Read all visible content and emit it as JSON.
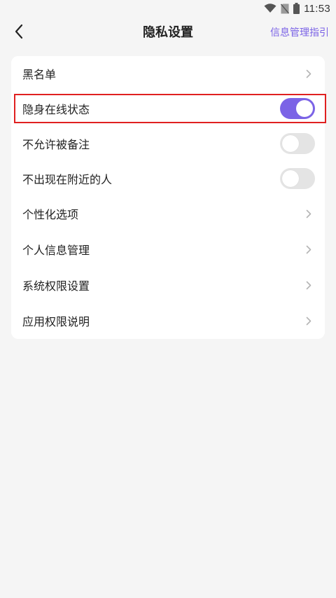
{
  "status_bar": {
    "time": "11:53",
    "icons": [
      "wifi-icon",
      "no-sim-icon",
      "battery-icon"
    ]
  },
  "header": {
    "back_icon": "chevron-left-icon",
    "title": "隐私设置",
    "right_link": "信息管理指引"
  },
  "settings": {
    "items": [
      {
        "label": "黑名单",
        "control": "chevron"
      },
      {
        "label": "隐身在线状态",
        "control": "toggle",
        "on": true
      },
      {
        "label": "不允许被备注",
        "control": "toggle",
        "on": false
      },
      {
        "label": "不出现在附近的人",
        "control": "toggle",
        "on": false
      },
      {
        "label": "个性化选项",
        "control": "chevron"
      },
      {
        "label": "个人信息管理",
        "control": "chevron"
      },
      {
        "label": "系统权限设置",
        "control": "chevron"
      },
      {
        "label": "应用权限说明",
        "control": "chevron"
      }
    ]
  },
  "colors": {
    "accent": "#7b63e6",
    "background": "#f5f5f5",
    "card": "#ffffff",
    "toggle_off": "#e4e4e4",
    "highlight_border": "#e02020"
  }
}
